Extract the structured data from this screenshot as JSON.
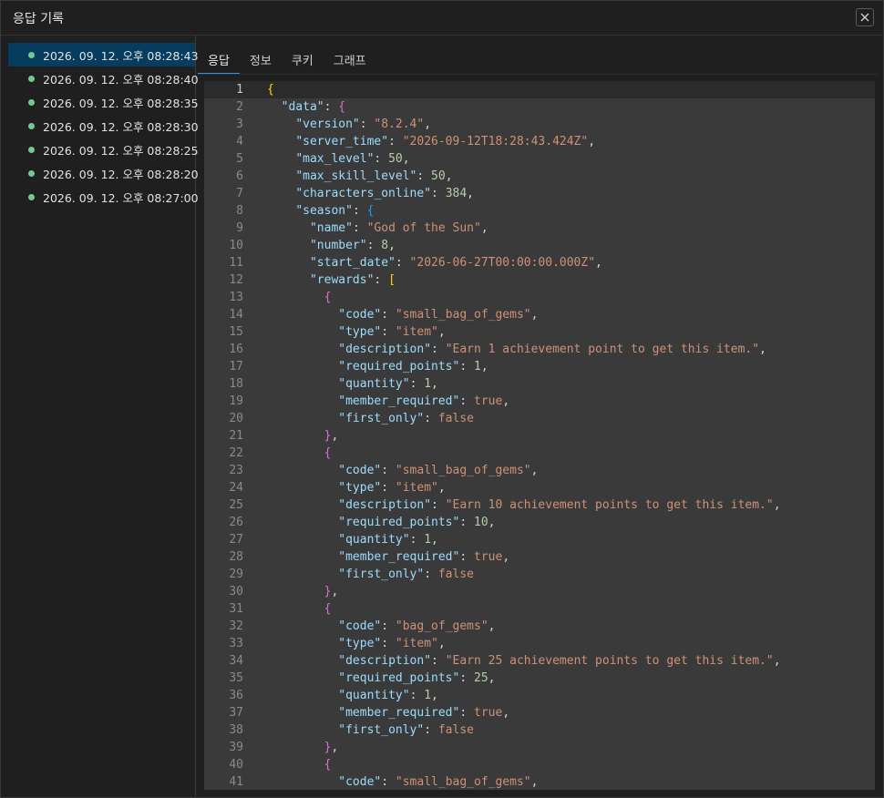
{
  "dialog": {
    "title": "응답 기록"
  },
  "history": [
    {
      "label": "2026. 09. 12. 오후 08:28:43",
      "active": true
    },
    {
      "label": "2026. 09. 12. 오후 08:28:40",
      "active": false
    },
    {
      "label": "2026. 09. 12. 오후 08:28:35",
      "active": false
    },
    {
      "label": "2026. 09. 12. 오후 08:28:30",
      "active": false
    },
    {
      "label": "2026. 09. 12. 오후 08:28:25",
      "active": false
    },
    {
      "label": "2026. 09. 12. 오후 08:28:20",
      "active": false
    },
    {
      "label": "2026. 09. 12. 오후 08:27:00",
      "active": false
    }
  ],
  "tabs": [
    {
      "label": "응답",
      "active": true
    },
    {
      "label": "정보",
      "active": false
    },
    {
      "label": "쿠키",
      "active": false
    },
    {
      "label": "그래프",
      "active": false
    }
  ],
  "colors": {
    "status_dot": "#73c991",
    "active_item_bg": "#063c5e",
    "tab_underline": "#3d8ed4",
    "editor_bg": "#3a3a3a"
  },
  "editor": {
    "lines": [
      [
        [
          0,
          "br1",
          "{"
        ]
      ],
      [
        [
          2,
          "k",
          "\"data\""
        ],
        [
          0,
          "p",
          ": "
        ],
        [
          0,
          "br2",
          "{"
        ]
      ],
      [
        [
          4,
          "k",
          "\"version\""
        ],
        [
          0,
          "p",
          ": "
        ],
        [
          0,
          "s",
          "\"8.2.4\""
        ],
        [
          0,
          "p",
          ","
        ]
      ],
      [
        [
          4,
          "k",
          "\"server_time\""
        ],
        [
          0,
          "p",
          ": "
        ],
        [
          0,
          "s",
          "\"2026-09-12T18:28:43.424Z\""
        ],
        [
          0,
          "p",
          ","
        ]
      ],
      [
        [
          4,
          "k",
          "\"max_level\""
        ],
        [
          0,
          "p",
          ": "
        ],
        [
          0,
          "n",
          "50"
        ],
        [
          0,
          "p",
          ","
        ]
      ],
      [
        [
          4,
          "k",
          "\"max_skill_level\""
        ],
        [
          0,
          "p",
          ": "
        ],
        [
          0,
          "n",
          "50"
        ],
        [
          0,
          "p",
          ","
        ]
      ],
      [
        [
          4,
          "k",
          "\"characters_online\""
        ],
        [
          0,
          "p",
          ": "
        ],
        [
          0,
          "n",
          "384"
        ],
        [
          0,
          "p",
          ","
        ]
      ],
      [
        [
          4,
          "k",
          "\"season\""
        ],
        [
          0,
          "p",
          ": "
        ],
        [
          0,
          "br3",
          "{"
        ]
      ],
      [
        [
          6,
          "k",
          "\"name\""
        ],
        [
          0,
          "p",
          ": "
        ],
        [
          0,
          "s",
          "\"God of the Sun\""
        ],
        [
          0,
          "p",
          ","
        ]
      ],
      [
        [
          6,
          "k",
          "\"number\""
        ],
        [
          0,
          "p",
          ": "
        ],
        [
          0,
          "n",
          "8"
        ],
        [
          0,
          "p",
          ","
        ]
      ],
      [
        [
          6,
          "k",
          "\"start_date\""
        ],
        [
          0,
          "p",
          ": "
        ],
        [
          0,
          "s",
          "\"2026-06-27T00:00:00.000Z\""
        ],
        [
          0,
          "p",
          ","
        ]
      ],
      [
        [
          6,
          "k",
          "\"rewards\""
        ],
        [
          0,
          "p",
          ": "
        ],
        [
          0,
          "br1",
          "["
        ]
      ],
      [
        [
          8,
          "br2",
          "{"
        ]
      ],
      [
        [
          10,
          "k",
          "\"code\""
        ],
        [
          0,
          "p",
          ": "
        ],
        [
          0,
          "s",
          "\"small_bag_of_gems\""
        ],
        [
          0,
          "p",
          ","
        ]
      ],
      [
        [
          10,
          "k",
          "\"type\""
        ],
        [
          0,
          "p",
          ": "
        ],
        [
          0,
          "s",
          "\"item\""
        ],
        [
          0,
          "p",
          ","
        ]
      ],
      [
        [
          10,
          "k",
          "\"description\""
        ],
        [
          0,
          "p",
          ": "
        ],
        [
          0,
          "s",
          "\"Earn 1 achievement point to get this item.\""
        ],
        [
          0,
          "p",
          ","
        ]
      ],
      [
        [
          10,
          "k",
          "\"required_points\""
        ],
        [
          0,
          "p",
          ": "
        ],
        [
          0,
          "n",
          "1"
        ],
        [
          0,
          "p",
          ","
        ]
      ],
      [
        [
          10,
          "k",
          "\"quantity\""
        ],
        [
          0,
          "p",
          ": "
        ],
        [
          0,
          "n",
          "1"
        ],
        [
          0,
          "p",
          ","
        ]
      ],
      [
        [
          10,
          "k",
          "\"member_required\""
        ],
        [
          0,
          "p",
          ": "
        ],
        [
          0,
          "s",
          "true"
        ],
        [
          0,
          "p",
          ","
        ]
      ],
      [
        [
          10,
          "k",
          "\"first_only\""
        ],
        [
          0,
          "p",
          ": "
        ],
        [
          0,
          "s",
          "false"
        ]
      ],
      [
        [
          8,
          "br2",
          "}"
        ],
        [
          0,
          "p",
          ","
        ]
      ],
      [
        [
          8,
          "br2",
          "{"
        ]
      ],
      [
        [
          10,
          "k",
          "\"code\""
        ],
        [
          0,
          "p",
          ": "
        ],
        [
          0,
          "s",
          "\"small_bag_of_gems\""
        ],
        [
          0,
          "p",
          ","
        ]
      ],
      [
        [
          10,
          "k",
          "\"type\""
        ],
        [
          0,
          "p",
          ": "
        ],
        [
          0,
          "s",
          "\"item\""
        ],
        [
          0,
          "p",
          ","
        ]
      ],
      [
        [
          10,
          "k",
          "\"description\""
        ],
        [
          0,
          "p",
          ": "
        ],
        [
          0,
          "s",
          "\"Earn 10 achievement points to get this item.\""
        ],
        [
          0,
          "p",
          ","
        ]
      ],
      [
        [
          10,
          "k",
          "\"required_points\""
        ],
        [
          0,
          "p",
          ": "
        ],
        [
          0,
          "n",
          "10"
        ],
        [
          0,
          "p",
          ","
        ]
      ],
      [
        [
          10,
          "k",
          "\"quantity\""
        ],
        [
          0,
          "p",
          ": "
        ],
        [
          0,
          "n",
          "1"
        ],
        [
          0,
          "p",
          ","
        ]
      ],
      [
        [
          10,
          "k",
          "\"member_required\""
        ],
        [
          0,
          "p",
          ": "
        ],
        [
          0,
          "s",
          "true"
        ],
        [
          0,
          "p",
          ","
        ]
      ],
      [
        [
          10,
          "k",
          "\"first_only\""
        ],
        [
          0,
          "p",
          ": "
        ],
        [
          0,
          "s",
          "false"
        ]
      ],
      [
        [
          8,
          "br2",
          "}"
        ],
        [
          0,
          "p",
          ","
        ]
      ],
      [
        [
          8,
          "br2",
          "{"
        ]
      ],
      [
        [
          10,
          "k",
          "\"code\""
        ],
        [
          0,
          "p",
          ": "
        ],
        [
          0,
          "s",
          "\"bag_of_gems\""
        ],
        [
          0,
          "p",
          ","
        ]
      ],
      [
        [
          10,
          "k",
          "\"type\""
        ],
        [
          0,
          "p",
          ": "
        ],
        [
          0,
          "s",
          "\"item\""
        ],
        [
          0,
          "p",
          ","
        ]
      ],
      [
        [
          10,
          "k",
          "\"description\""
        ],
        [
          0,
          "p",
          ": "
        ],
        [
          0,
          "s",
          "\"Earn 25 achievement points to get this item.\""
        ],
        [
          0,
          "p",
          ","
        ]
      ],
      [
        [
          10,
          "k",
          "\"required_points\""
        ],
        [
          0,
          "p",
          ": "
        ],
        [
          0,
          "n",
          "25"
        ],
        [
          0,
          "p",
          ","
        ]
      ],
      [
        [
          10,
          "k",
          "\"quantity\""
        ],
        [
          0,
          "p",
          ": "
        ],
        [
          0,
          "n",
          "1"
        ],
        [
          0,
          "p",
          ","
        ]
      ],
      [
        [
          10,
          "k",
          "\"member_required\""
        ],
        [
          0,
          "p",
          ": "
        ],
        [
          0,
          "s",
          "true"
        ],
        [
          0,
          "p",
          ","
        ]
      ],
      [
        [
          10,
          "k",
          "\"first_only\""
        ],
        [
          0,
          "p",
          ": "
        ],
        [
          0,
          "s",
          "false"
        ]
      ],
      [
        [
          8,
          "br2",
          "}"
        ],
        [
          0,
          "p",
          ","
        ]
      ],
      [
        [
          8,
          "br2",
          "{"
        ]
      ],
      [
        [
          10,
          "k",
          "\"code\""
        ],
        [
          0,
          "p",
          ": "
        ],
        [
          0,
          "s",
          "\"small_bag_of_gems\""
        ],
        [
          0,
          "p",
          ","
        ]
      ]
    ]
  }
}
